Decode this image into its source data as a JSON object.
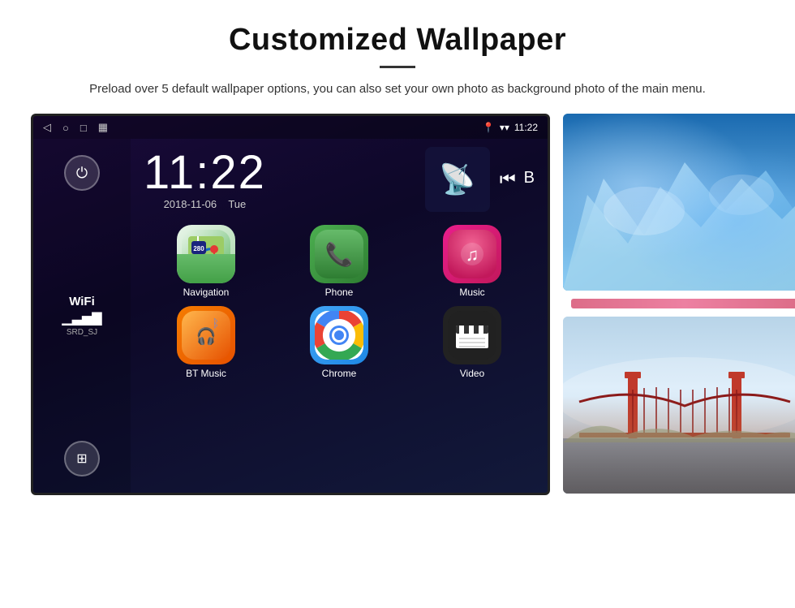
{
  "header": {
    "title": "Customized Wallpaper",
    "divider": true,
    "description": "Preload over 5 default wallpaper options, you can also set your own photo as background photo of the main menu."
  },
  "screen": {
    "status_bar": {
      "time": "11:22",
      "nav_icons": [
        "◁",
        "○",
        "□",
        "▦"
      ],
      "right_icons": [
        "location",
        "wifi",
        "11:22"
      ]
    },
    "clock": {
      "time": "11:22",
      "date": "2018-11-06",
      "day": "Tue"
    },
    "sidebar": {
      "power_icon": "⏻",
      "wifi_label": "WiFi",
      "wifi_ssid": "SRD_SJ",
      "apps_icon": "⊞"
    },
    "apps": [
      {
        "label": "Navigation",
        "type": "nav"
      },
      {
        "label": "Phone",
        "type": "phone"
      },
      {
        "label": "Music",
        "type": "music"
      },
      {
        "label": "BT Music",
        "type": "bt"
      },
      {
        "label": "Chrome",
        "type": "chrome"
      },
      {
        "label": "Video",
        "type": "video"
      }
    ]
  },
  "wallpapers": [
    {
      "type": "ice",
      "alt": "Ice glacier wallpaper"
    },
    {
      "type": "bridge",
      "alt": "Golden Gate Bridge wallpaper"
    }
  ]
}
